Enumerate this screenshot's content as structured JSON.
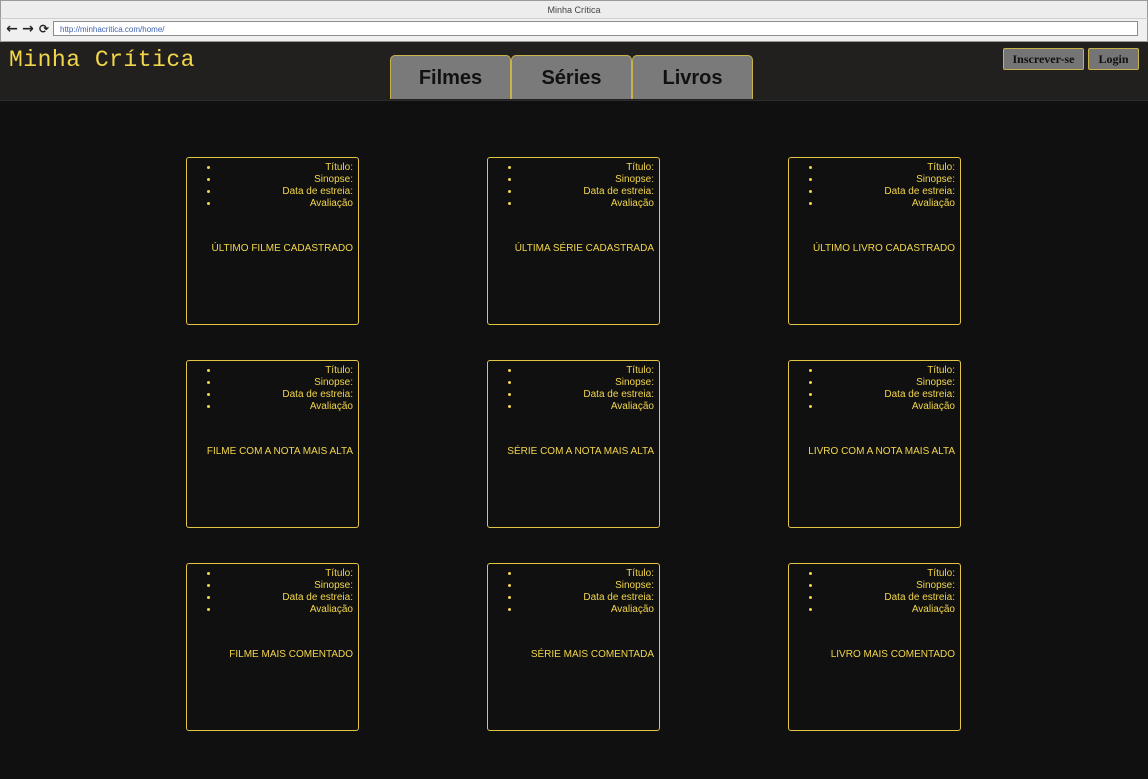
{
  "browser": {
    "window_title": "Minha Crítica",
    "url": "http://minhacritica.com/home/",
    "back_icon": "arrow-left-icon",
    "forward_icon": "arrow-right-icon",
    "reload_icon": "reload-icon"
  },
  "header": {
    "logo": "Minha Crítica",
    "tabs": [
      {
        "label": "Filmes"
      },
      {
        "label": "Séries"
      },
      {
        "label": "Livros"
      }
    ],
    "signup_label": "Inscrever-se",
    "login_label": "Login"
  },
  "card_fields": [
    "Título:",
    "Sinopse:",
    "Data de estreia:",
    "Avaliação"
  ],
  "cards": [
    {
      "caption": "ÚLTIMO FILME CADASTRADO"
    },
    {
      "caption": "ÚLTIMA SÉRIE CADASTRADA"
    },
    {
      "caption": "ÚLTIMO LIVRO CADASTRADO"
    },
    {
      "caption": "FILME COM A NOTA MAIS ALTA"
    },
    {
      "caption": "SÉRIE COM A NOTA MAIS ALTA"
    },
    {
      "caption": "LIVRO COM A NOTA MAIS ALTA"
    },
    {
      "caption": "FILME MAIS COMENTADO"
    },
    {
      "caption": "SÉRIE MAIS COMENTADA"
    },
    {
      "caption": "LIVRO MAIS COMENTADO"
    }
  ],
  "colors": {
    "background": "#101010",
    "header": "#221f1f",
    "accent": "#f2d64b",
    "tab": "#7a7a7a"
  }
}
